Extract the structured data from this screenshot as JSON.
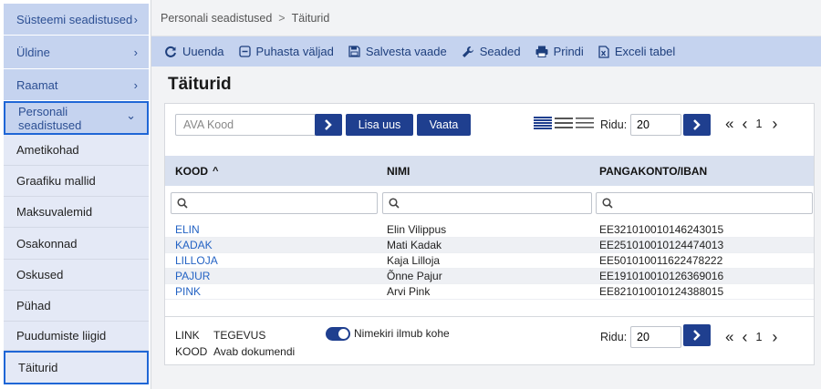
{
  "sidebar": {
    "items": [
      {
        "label": "Süsteemi seadistused",
        "chevron": "›",
        "kind": "top"
      },
      {
        "label": "Üldine",
        "chevron": "›",
        "kind": "top"
      },
      {
        "label": "Raamat",
        "chevron": "›",
        "kind": "top"
      },
      {
        "label": "Personali seadistused",
        "chevron": "⌄",
        "kind": "top-active"
      },
      {
        "label": "Ametikohad",
        "kind": "sub"
      },
      {
        "label": "Graafiku mallid",
        "kind": "sub"
      },
      {
        "label": "Maksuvalemid",
        "kind": "sub"
      },
      {
        "label": "Osakonnad",
        "kind": "sub"
      },
      {
        "label": "Oskused",
        "kind": "sub"
      },
      {
        "label": "Pühad",
        "kind": "sub"
      },
      {
        "label": "Puudumiste liigid",
        "kind": "sub"
      },
      {
        "label": "Täiturid",
        "kind": "sub-active"
      }
    ]
  },
  "breadcrumb": {
    "parent": "Personali seadistused",
    "separator": ">",
    "current": "Täiturid"
  },
  "toolbar": {
    "refresh": "Uuenda",
    "clear": "Puhasta väljad",
    "save_view": "Salvesta vaade",
    "settings": "Seaded",
    "print": "Prindi",
    "excel": "Exceli tabel"
  },
  "page": {
    "title": "Täiturid"
  },
  "controls": {
    "kood_placeholder": "AVA Kood",
    "add_new": "Lisa uus",
    "view": "Vaata",
    "rows_label": "Ridu:",
    "rows_value": "20",
    "current_page": "1",
    "first_icon": "«",
    "prev_icon": "‹",
    "next_icon": "›"
  },
  "table": {
    "columns": [
      {
        "label": "KOOD",
        "sort": "^"
      },
      {
        "label": "NIMI"
      },
      {
        "label": "PANGAKONTO/IBAN"
      }
    ],
    "rows": [
      {
        "kood": "ELIN",
        "nimi": "Elin Vilippus",
        "iban": "EE321010010146243015"
      },
      {
        "kood": "KADAK",
        "nimi": "Mati Kadak",
        "iban": "EE251010010124474013"
      },
      {
        "kood": "LILLOJA",
        "nimi": "Kaja Lilloja",
        "iban": "EE501010011622478222"
      },
      {
        "kood": "PAJUR",
        "nimi": "Õnne Pajur",
        "iban": "EE191010010126369016"
      },
      {
        "kood": "PINK",
        "nimi": "Arvi Pink",
        "iban": "EE821010010124388015"
      }
    ]
  },
  "footer": {
    "legend_link": "LINK",
    "legend_action": "TEGEVUS",
    "legend_kood": "KOOD",
    "legend_opens": "Avab dokumendi",
    "toggle_label": "Nimekiri ilmub kohe",
    "rows_label": "Ridu:",
    "rows_value": "20",
    "current_page": "1"
  },
  "colors": {
    "accent": "#1f3f8f",
    "sidebar_top": "#c5d3ef",
    "sidebar_sub": "#e4e9f6",
    "link": "#2463c4"
  }
}
